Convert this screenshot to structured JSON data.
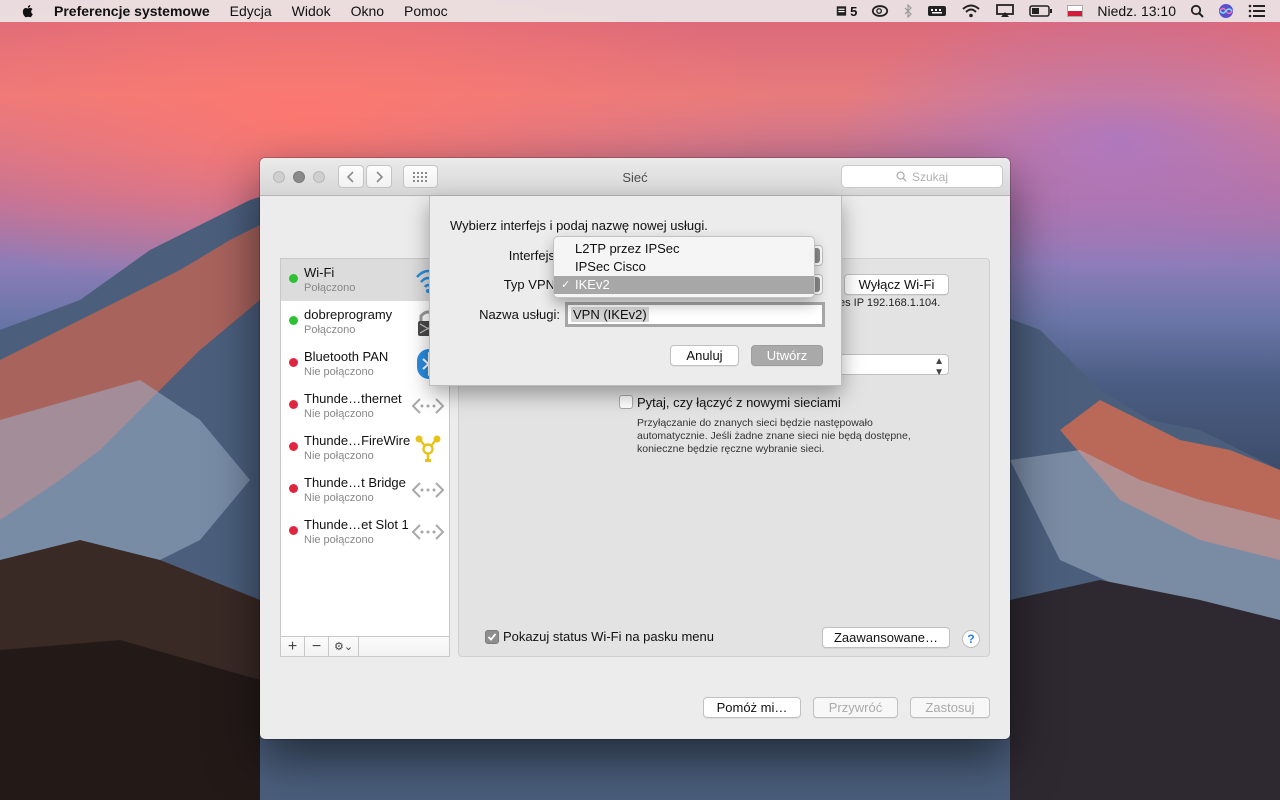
{
  "menubar": {
    "app_name": "Preferencje systemowe",
    "items": [
      "Edycja",
      "Widok",
      "Okno",
      "Pomoc"
    ],
    "badge_count": "5",
    "datetime": "Niedz. 13:10"
  },
  "window": {
    "title": "Sieć",
    "search_placeholder": "Szukaj"
  },
  "sidebar": {
    "services": [
      {
        "name": "Wi-Fi",
        "status": "Połączono",
        "color": "#2fc036",
        "icon": "wifi-icon"
      },
      {
        "name": "dobreprogramy",
        "status": "Połączono",
        "color": "#2fc036",
        "icon": "lock-icon"
      },
      {
        "name": "Bluetooth PAN",
        "status": "Nie połączono",
        "color": "#e0263f",
        "icon": "bluetooth-icon"
      },
      {
        "name": "Thunde…thernet",
        "status": "Nie połączono",
        "color": "#e0263f",
        "icon": "ethernet-arrows-icon"
      },
      {
        "name": "Thunde…FireWire",
        "status": "Nie połączono",
        "color": "#e0263f",
        "icon": "firewire-icon"
      },
      {
        "name": "Thunde…t Bridge",
        "status": "Nie połączono",
        "color": "#e0263f",
        "icon": "ethernet-arrows-icon"
      },
      {
        "name": "Thunde…et Slot 1",
        "status": "Nie połączono",
        "color": "#e0263f",
        "icon": "ethernet-arrows-icon"
      }
    ],
    "add_label": "+",
    "remove_label": "−",
    "gear_label": "⚙︎⌄"
  },
  "panel": {
    "wifi_off_label": "Wyłącz Wi-Fi",
    "ip_text": "es IP 192.168.1.104.",
    "ask_label": "Pytaj, czy łączyć z nowymi sieciami",
    "ask_description": "Przyłączanie do znanych sieci będzie następowało automatycznie. Jeśli żadne znane sieci nie będą dostępne, konieczne będzie ręczne wybranie sieci.",
    "show_status_label": "Pokazuj status Wi-Fi na pasku menu",
    "show_status_checked": true,
    "advanced_label": "Zaawansowane…",
    "help_label": "?"
  },
  "footer": {
    "assist_label": "Pomóż mi…",
    "revert_label": "Przywróć",
    "apply_label": "Zastosuj"
  },
  "sheet": {
    "title": "Wybierz interfejs i podaj nazwę nowej usługi.",
    "interface_label": "Interfejs",
    "vpn_type_label": "Typ VPN",
    "service_name_label": "Nazwa usługi:",
    "service_name_value": "VPN (IKEv2)",
    "cancel_label": "Anuluj",
    "create_label": "Utwórz"
  },
  "dropdown": {
    "options": [
      "L2TP przez IPSec",
      "IPSec Cisco",
      "IKEv2"
    ],
    "selected": "IKEv2",
    "check_mark": "✓"
  }
}
